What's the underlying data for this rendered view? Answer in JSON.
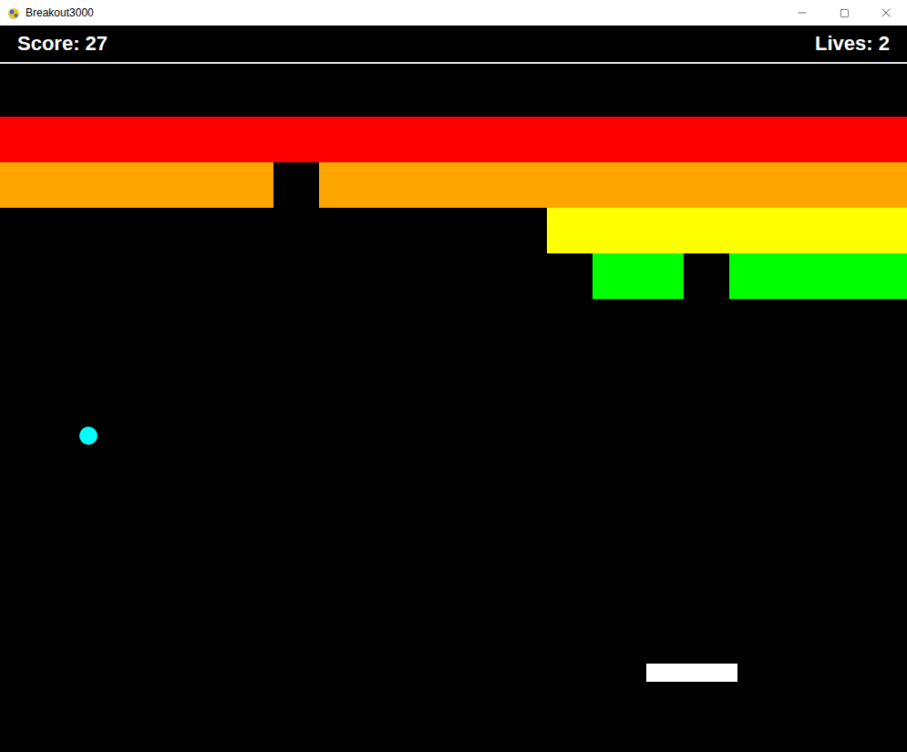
{
  "window": {
    "title": "Breakout3000"
  },
  "hud": {
    "score": "Score: 27",
    "lives": "Lives: 2"
  },
  "bricks": {
    "rows": [
      {
        "color": "#ff0000",
        "bricks": [
          true,
          true,
          true,
          true,
          true,
          true,
          true,
          true,
          true,
          true,
          true,
          true,
          true,
          true,
          true,
          true,
          true,
          true,
          true,
          true
        ]
      },
      {
        "color": "#ffa500",
        "bricks": [
          true,
          true,
          true,
          true,
          true,
          true,
          false,
          true,
          true,
          true,
          true,
          true,
          true,
          true,
          true,
          true,
          true,
          true,
          true,
          true
        ]
      },
      {
        "color": "#ffff00",
        "bricks": [
          false,
          false,
          false,
          false,
          false,
          false,
          false,
          false,
          false,
          false,
          false,
          false,
          true,
          true,
          true,
          true,
          true,
          true,
          true,
          true
        ]
      },
      {
        "color": "#00ff00",
        "bricks": [
          false,
          false,
          false,
          false,
          false,
          false,
          false,
          false,
          false,
          false,
          false,
          false,
          false,
          true,
          true,
          false,
          true,
          true,
          true,
          true
        ]
      }
    ]
  }
}
